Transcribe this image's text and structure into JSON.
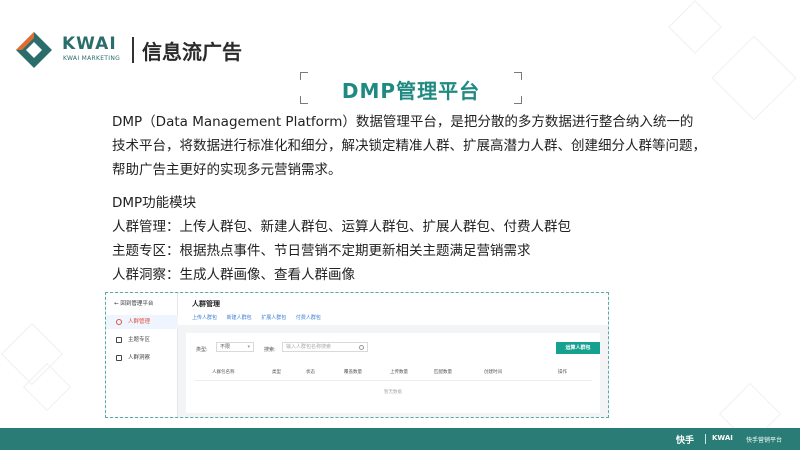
{
  "header": {
    "logo_text": "KWAI",
    "logo_sub": "KWAI MARKETING",
    "section_title": "信息流广告",
    "brand_color": "#2b6d6a"
  },
  "slide": {
    "title": "DMP管理平台",
    "title_color": "#1f8a82",
    "intro_lines": [
      "DMP（Data Management Platform）数据管理平台，是把分散的多方数据进行整合纳入统一的",
      "技术平台，将数据进行标准化和细分，解决锁定精准人群、扩展高潜力人群、创建细分人群等问题，",
      "帮助广告主更好的实现多元营销需求。"
    ],
    "modules_title": "DMP功能模块",
    "modules": [
      "人群管理：上传人群包、新建人群包、运算人群包、扩展人群包、付费人群包",
      "主题专区：根据热点事件、节日营销不定期更新相关主题满足营销需求",
      "人群洞察：生成人群画像、查看人群画像"
    ]
  },
  "screenshot": {
    "back_label": "回到管理平台",
    "sidebar": [
      {
        "label": "人群管理",
        "icon": "user-icon",
        "active": true
      },
      {
        "label": "主题专区",
        "icon": "grid-icon",
        "active": false
      },
      {
        "label": "人群洞察",
        "icon": "chart-icon",
        "active": false
      }
    ],
    "page_title": "人群管理",
    "tabs": [
      "上传人群包",
      "新建人群包",
      "扩展人群包",
      "付费人群包"
    ],
    "filter_type_label": "类型:",
    "filter_type_value": "不限",
    "search_label": "搜索:",
    "search_placeholder": "输入人群包名称搜索",
    "new_button": "运算人群包",
    "columns": [
      "人群包名称",
      "类型",
      "状态",
      "覆盖数量",
      "上传数量",
      "匹配数量",
      "创建时间",
      "操作"
    ],
    "empty_text": "暂无数据",
    "accent_color": "#16a08f",
    "active_color": "#e0533e"
  },
  "footer": {
    "logo1": "快手",
    "logo2": "KWAI",
    "tagline": "快手营销平台",
    "bar_color": "#2a7c76"
  }
}
